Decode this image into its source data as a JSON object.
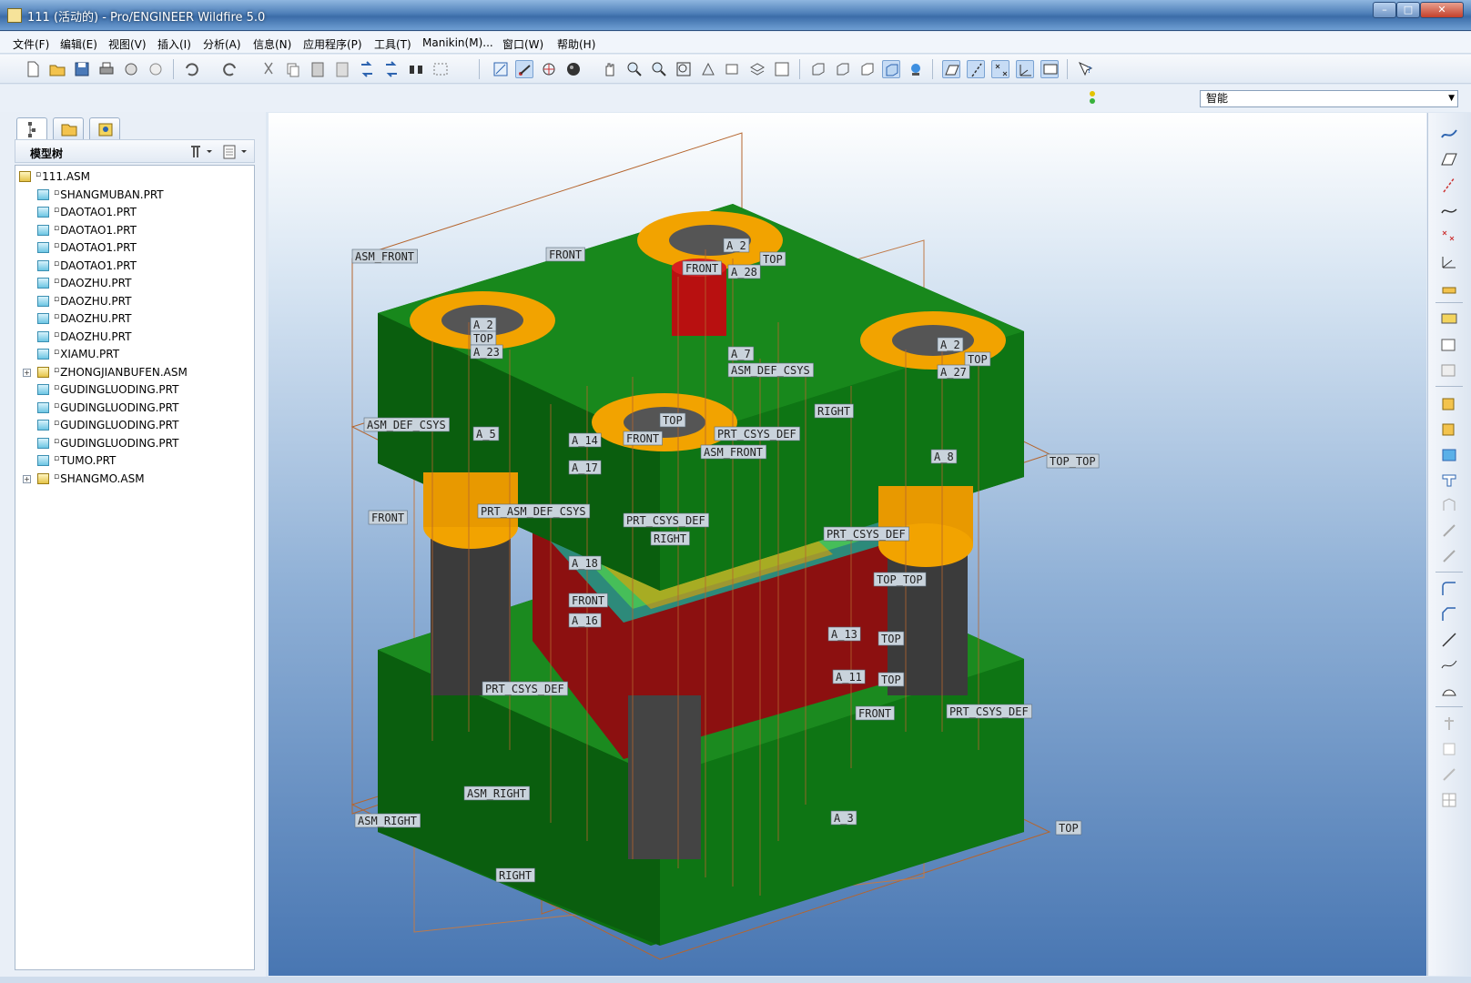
{
  "window": {
    "title": "111 (活动的) - Pro/ENGINEER Wildfire 5.0"
  },
  "menu": [
    "文件(F)",
    "编辑(E)",
    "视图(V)",
    "插入(I)",
    "分析(A)",
    "信息(N)",
    "应用程序(P)",
    "工具(T)",
    "Manikin(M)...",
    "窗口(W)",
    "帮助(H)"
  ],
  "filter": {
    "value": "智能"
  },
  "panel": {
    "tree_title": "模型树"
  },
  "tree": [
    {
      "label": "111.ASM",
      "type": "asm",
      "level": 0
    },
    {
      "label": "SHANGMUBAN.PRT",
      "type": "prt",
      "level": 1
    },
    {
      "label": "DAOTAO1.PRT",
      "type": "prt",
      "level": 1
    },
    {
      "label": "DAOTAO1.PRT",
      "type": "prt",
      "level": 1
    },
    {
      "label": "DAOTAO1.PRT",
      "type": "prt",
      "level": 1
    },
    {
      "label": "DAOTAO1.PRT",
      "type": "prt",
      "level": 1
    },
    {
      "label": "DAOZHU.PRT",
      "type": "prt",
      "level": 1
    },
    {
      "label": "DAOZHU.PRT",
      "type": "prt",
      "level": 1
    },
    {
      "label": "DAOZHU.PRT",
      "type": "prt",
      "level": 1
    },
    {
      "label": "DAOZHU.PRT",
      "type": "prt",
      "level": 1
    },
    {
      "label": "XIAMU.PRT",
      "type": "prt",
      "level": 1
    },
    {
      "label": "ZHONGJIANBUFEN.ASM",
      "type": "asm",
      "level": 1,
      "expandable": true
    },
    {
      "label": "GUDINGLUODING.PRT",
      "type": "prt",
      "level": 1
    },
    {
      "label": "GUDINGLUODING.PRT",
      "type": "prt",
      "level": 1
    },
    {
      "label": "GUDINGLUODING.PRT",
      "type": "prt",
      "level": 1
    },
    {
      "label": "GUDINGLUODING.PRT",
      "type": "prt",
      "level": 1
    },
    {
      "label": "TUMO.PRT",
      "type": "prt",
      "level": 1
    },
    {
      "label": "SHANGMO.ASM",
      "type": "asm",
      "level": 1,
      "expandable": true
    }
  ],
  "datum_labels": [
    "ASM_FRONT",
    "FRONT",
    "A_2",
    "TOP",
    "FRONT",
    "A_28",
    "A_2",
    "TOP",
    "A_23",
    "A_2",
    "TOP",
    "A_27",
    "A_7",
    "ASM_DEF_CSYS",
    "ASM_DEF_CSYS",
    "A_5",
    "RIGHT",
    "TOP",
    "PRT_CSYS_DEF",
    "FRONT",
    "ASM_FRONT",
    "A_14",
    "A_17",
    "A_8",
    "TOP_TOP",
    "FRONT",
    "PRT_ASM_DEF_CSYS",
    "PRT_CSYS_DEF",
    "RIGHT",
    "PRT_CSYS_DEF",
    "A_18",
    "FRONT",
    "TOP_TOP",
    "A_16",
    "A_13",
    "TOP",
    "A_11",
    "TOP",
    "FRONT",
    "PRT_CSYS_DEF",
    "PRT_CSYS_DEF",
    "ASM_RIGHT",
    "ASM_RIGHT",
    "TOP",
    "RIGHT",
    "A_3"
  ],
  "colors": {
    "accent": "#3b6ca8",
    "plate_green": "#0f7a14",
    "bushing_orange": "#f2a300",
    "datum_line": "#b5652e"
  }
}
